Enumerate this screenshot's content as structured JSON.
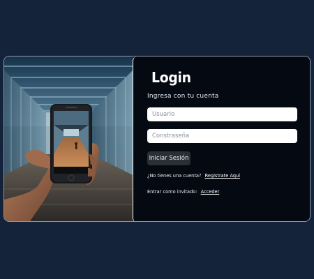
{
  "login": {
    "title": "Login",
    "subtitle": "Ingresa con tu cuenta",
    "username_placeholder": "Usuario",
    "username_value": "",
    "password_placeholder": "Constraseña",
    "password_value": "",
    "submit_label": "Iniciar Sesión",
    "register_prompt": "¿No tienes una cuenta?",
    "register_link": "Registrate Aquí",
    "guest_prompt": "Entrar como invitado:",
    "guest_link": "Acceder"
  },
  "colors": {
    "page_background": "#15233a",
    "panel_background": "#050a12",
    "button_background": "#2a2f36",
    "input_background": "#ffffff"
  },
  "photo": {
    "subject": "hand-holding-smartphone-in-corridor"
  }
}
